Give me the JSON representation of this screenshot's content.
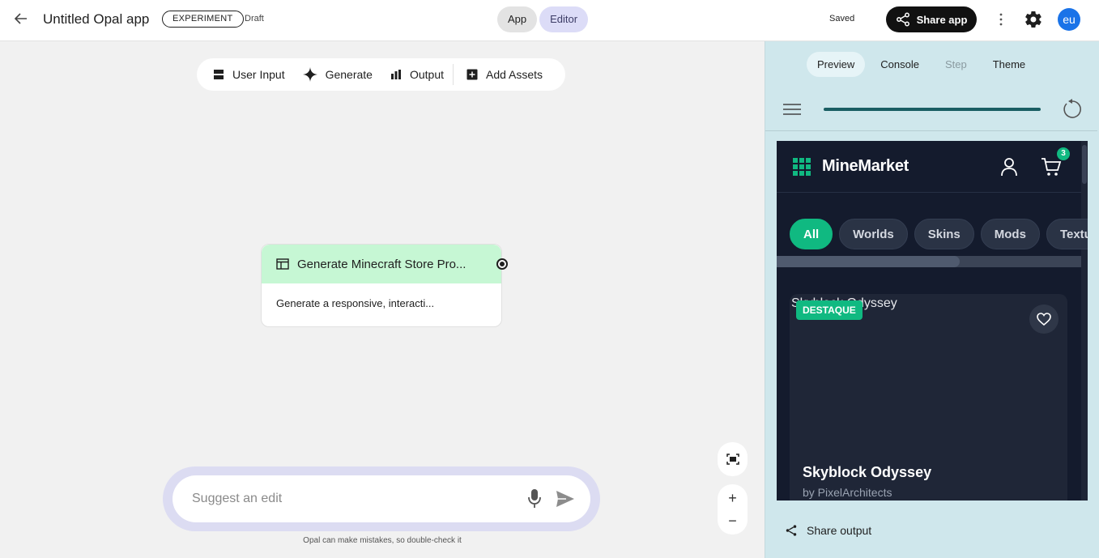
{
  "header": {
    "title": "Untitled Opal app",
    "badge": "EXPERIMENT",
    "status": "Draft",
    "mode_app": "App",
    "mode_editor": "Editor",
    "saved": "Saved",
    "share_app": "Share app",
    "avatar_initials": "eu"
  },
  "toolbar": {
    "user_input": "User Input",
    "generate": "Generate",
    "output": "Output",
    "add_assets": "Add Assets"
  },
  "node": {
    "title": "Generate Minecraft Store Pro...",
    "description": "Generate a responsive, interacti..."
  },
  "suggest": {
    "placeholder": "Suggest an edit",
    "disclaimer": "Opal can make mistakes, so double-check it"
  },
  "zoom": {
    "plus": "+",
    "minus": "−"
  },
  "panel": {
    "tabs": [
      "Preview",
      "Console",
      "Step",
      "Theme"
    ],
    "progress": 1.0,
    "share_output": "Share output"
  },
  "store": {
    "brand": "MineMarket",
    "cart_count": "3",
    "categories": [
      "All",
      "Worlds",
      "Skins",
      "Mods",
      "Textu"
    ],
    "card": {
      "image_alt": "Skyblock Odyssey",
      "badge": "DESTAQUE",
      "title": "Skyblock Odyssey",
      "author": "by PixelArchitects"
    }
  },
  "colors": {
    "accent_green": "#10b981",
    "node_header": "#c6f7d4",
    "editor_toggle": "#dcdcf7",
    "panel_bg": "#cfe7ec",
    "preview_bg": "#141b2d",
    "avatar": "#1a73e8"
  }
}
